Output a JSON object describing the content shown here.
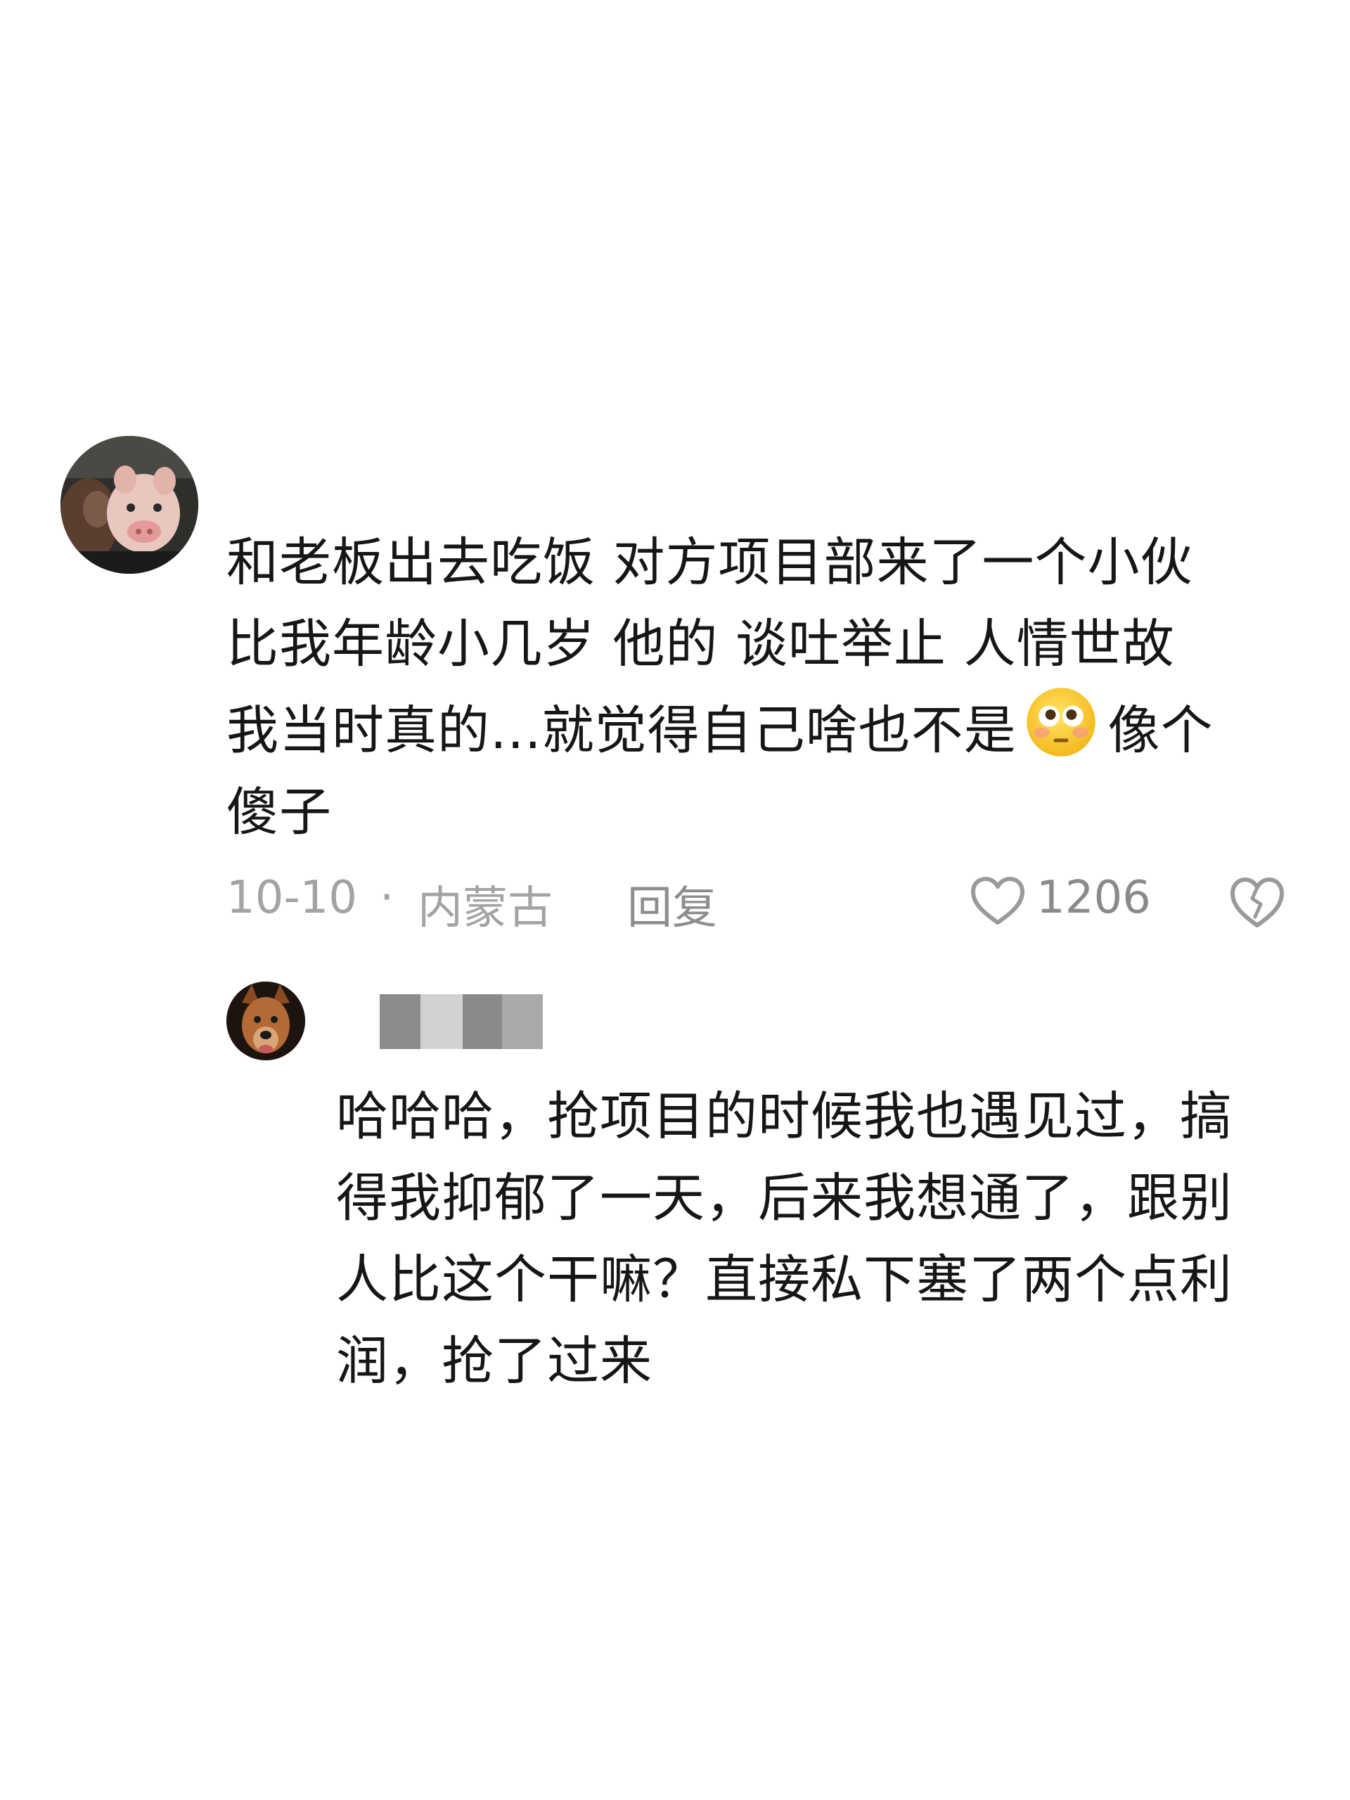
{
  "comment": {
    "avatar": "pig-avatar",
    "lines": [
      "和老板出去吃饭 对方项目部来了一个小伙",
      "比我年龄小几岁 他的 谈吐举止 人情世故",
      "我当时真的...就觉得自己啥也不是",
      "像个",
      "傻子"
    ],
    "emoji": "flushed-face-emoji",
    "date": "10-10",
    "separator": "·",
    "location": "内蒙古",
    "reply_label": "回复",
    "like_count": "1206",
    "like_icon": "heart-outline-icon",
    "dislike_icon": "broken-heart-icon"
  },
  "reply": {
    "avatar": "dog-avatar",
    "username_censored": true,
    "lines": [
      "哈哈哈，抢项目的时候我也遇见过，搞",
      "得我抑郁了一天，后来我想通了，跟别",
      "人比这个干嘛？直接私下塞了两个点利",
      "润，抢了过来"
    ]
  },
  "colors": {
    "background": "#ffffff",
    "text": "#161616",
    "meta": "#a3a3a3",
    "censor_dark": "#8a8a8a",
    "censor_light": "#cfcfcf"
  }
}
